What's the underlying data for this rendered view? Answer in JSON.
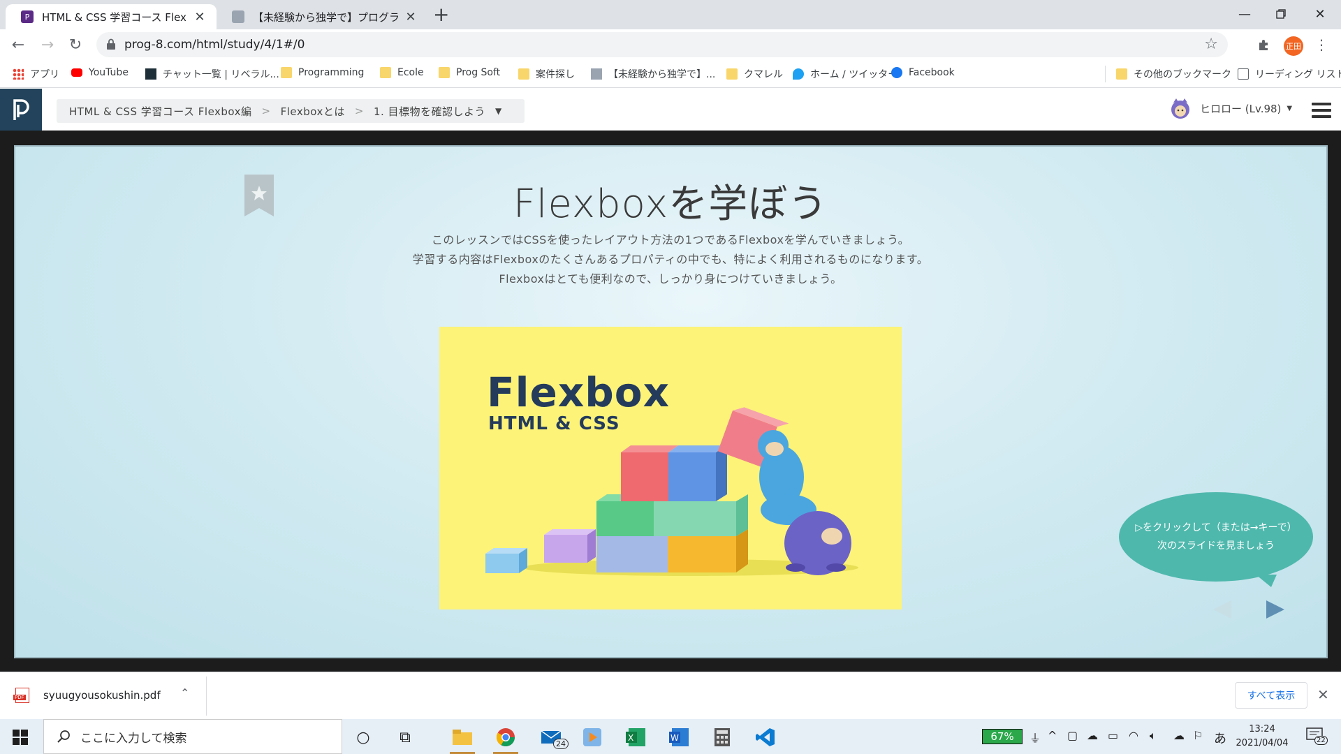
{
  "browser": {
    "tabs": [
      {
        "title": "HTML & CSS 学習コース Flexbox編",
        "active": true,
        "favicon_color": "#5b2a86"
      },
      {
        "title": "【未経験から独学で】プログラミング学",
        "active": false,
        "favicon_color": "#9aa4b1"
      }
    ],
    "url": "prog-8.com/html/study/4/1#/0",
    "profile_initials": "正田"
  },
  "bookmarks": [
    {
      "label": "アプリ",
      "icon": "apps-grid-icon"
    },
    {
      "label": "YouTube",
      "icon": "youtube-icon"
    },
    {
      "label": "チャット一覧 | リベラル...",
      "icon": "leaf-icon"
    },
    {
      "label": "Programming",
      "icon": "folder-icon"
    },
    {
      "label": "Ecole",
      "icon": "folder-icon"
    },
    {
      "label": "Prog Soft",
      "icon": "folder-icon"
    },
    {
      "label": "案件探し",
      "icon": "folder-icon"
    },
    {
      "label": "【未経験から独学で】...",
      "icon": "site-icon"
    },
    {
      "label": "クマレル",
      "icon": "folder-icon"
    },
    {
      "label": "ホーム / ツイッター",
      "icon": "twitter-icon"
    },
    {
      "label": "Facebook",
      "icon": "facebook-icon"
    }
  ],
  "bookmarks_right": [
    {
      "label": "その他のブックマーク",
      "icon": "folder-icon"
    },
    {
      "label": "リーディング リスト",
      "icon": "reading-list-icon"
    }
  ],
  "progate": {
    "breadcrumbs": [
      "HTML & CSS 学習コース Flexbox編",
      "Flexboxとは",
      "1. 目標物を確認しよう"
    ],
    "user_label": "ヒロロー (Lv.98)"
  },
  "slide": {
    "title": "Flexboxを学ぼう",
    "description": [
      "このレッスンではCSSを使ったレイアウト方法の1つであるFlexboxを学んでいきましょう。",
      "学習する内容はFlexboxのたくさんあるプロパティの中でも、特によく利用されるものになります。",
      "Flexboxはとても便利なので、しっかり身につけていきましょう。"
    ],
    "hero_title": "Flexbox",
    "hero_subtitle": "HTML & CSS",
    "hint_line1": "▷をクリックして（または→キーで）",
    "hint_line2": "次のスライドを見ましょう"
  },
  "download": {
    "filename": "syuugyousokushin.pdf",
    "show_all": "すべて表示"
  },
  "taskbar": {
    "search_placeholder": "ここに入力して検索",
    "battery": "67%",
    "time": "13:24",
    "date": "2021/04/04",
    "mail_badge": "24",
    "notifications": "22",
    "ime": "あ"
  },
  "colors": {
    "progate_navy": "#22435b",
    "slide_bg": "#d3ebf2",
    "hero_yellow": "#fcf378",
    "hint_teal": "#4fb8ad",
    "hero_text": "#243b5c"
  }
}
